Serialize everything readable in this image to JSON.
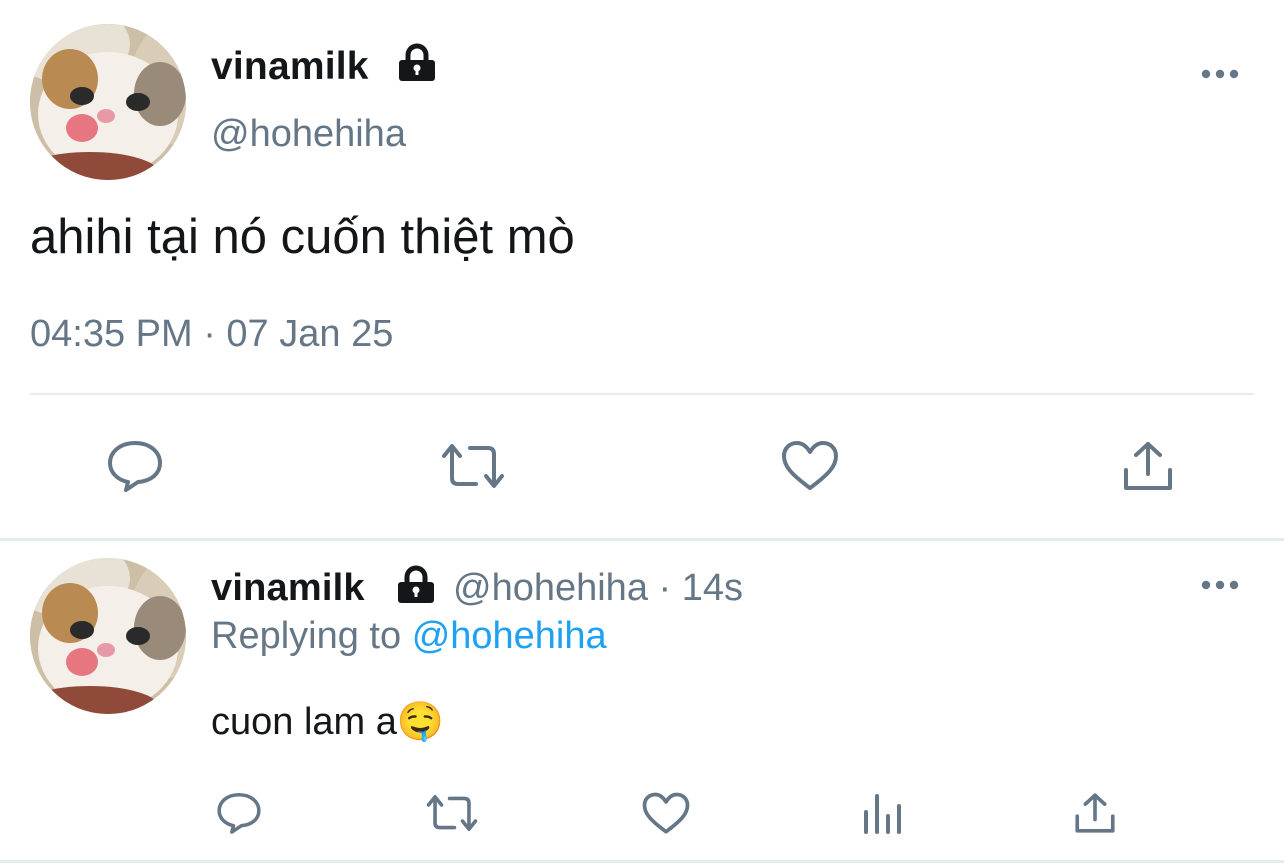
{
  "main_tweet": {
    "display_name": "vinamilk",
    "handle": "@hohehiha",
    "text": "ahihi tại nó cuốn thiệt mò",
    "timestamp": "04:35 PM · 07 Jan 25",
    "avatar_icon": "cat-avatar",
    "lock_icon": "lock-icon",
    "more_icon": "more-dots-icon",
    "actions": [
      {
        "name": "reply",
        "icon": "reply-icon"
      },
      {
        "name": "retweet",
        "icon": "retweet-icon"
      },
      {
        "name": "like",
        "icon": "heart-icon"
      },
      {
        "name": "share",
        "icon": "share-icon"
      }
    ]
  },
  "reply_tweet": {
    "display_name": "vinamilk",
    "handle": "@hohehiha",
    "time_sep": "·",
    "time_ago": "14s",
    "replying_prefix": "Replying to",
    "replying_handle": "@hohehiha",
    "text": "cuon lam a",
    "emoji": "🤤",
    "avatar_icon": "cat-avatar",
    "lock_icon": "lock-icon",
    "more_icon": "more-dots-icon",
    "actions": [
      {
        "name": "reply",
        "icon": "reply-icon"
      },
      {
        "name": "retweet",
        "icon": "retweet-icon"
      },
      {
        "name": "like",
        "icon": "heart-icon"
      },
      {
        "name": "analytics",
        "icon": "analytics-icon"
      },
      {
        "name": "share",
        "icon": "share-icon"
      }
    ]
  },
  "colors": {
    "text": "#14171a",
    "secondary": "#657786",
    "link": "#1da1f2",
    "divider": "#e6ecf0"
  }
}
